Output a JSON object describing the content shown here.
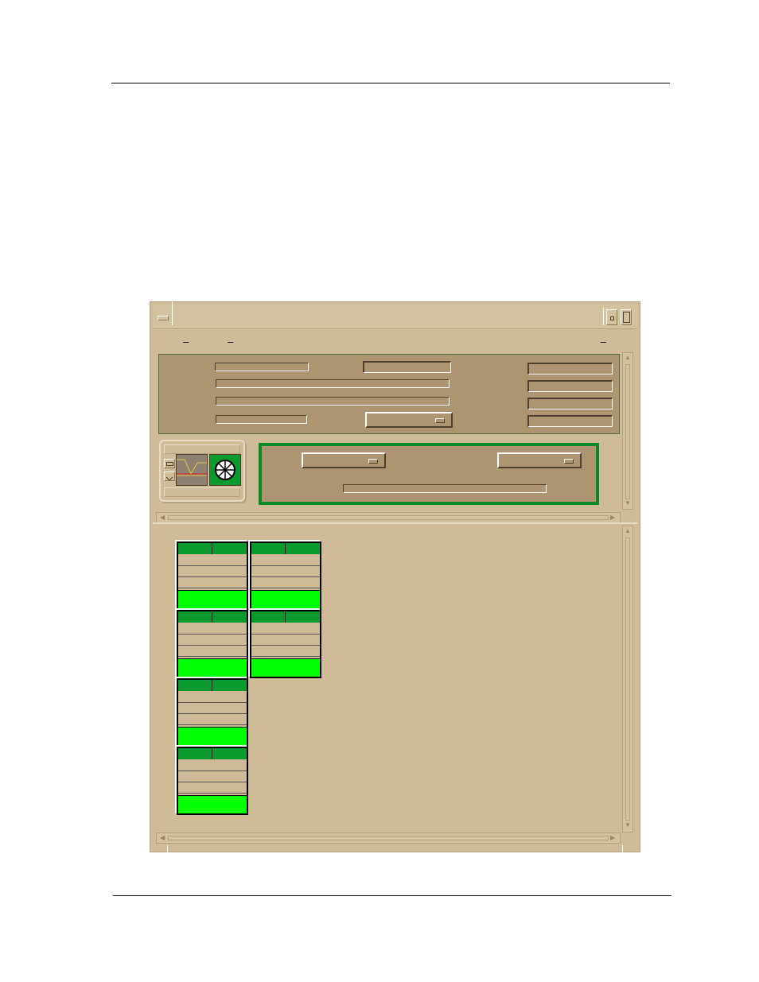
{
  "colors": {
    "window_bg": "#cfbb98",
    "panel_bg": "#ad9571",
    "green_dark": "#0b9a2e",
    "green_bright": "#00ff00",
    "frame_green": "#0a8a26"
  },
  "icons": {
    "window_menu": "window-menu-icon",
    "minimize": "minimize-icon",
    "maximize": "maximize-icon",
    "trend": "trend-graph-icon",
    "wheel": "wheel-icon"
  },
  "menu": {
    "items": [
      {
        "label": ""
      },
      {
        "label": ""
      },
      {
        "label": ""
      }
    ]
  },
  "top_panel": {
    "field_1": "",
    "field_2": "",
    "field_3": "",
    "field_4": "",
    "field_5": "",
    "option_1": "",
    "right_fields": [
      "",
      "",
      "",
      ""
    ]
  },
  "control_panel": {
    "option_a": "",
    "option_b": "",
    "status_field": ""
  },
  "tiles": [
    {
      "col": 0,
      "row": 0
    },
    {
      "col": 1,
      "row": 0
    },
    {
      "col": 0,
      "row": 1
    },
    {
      "col": 1,
      "row": 1
    },
    {
      "col": 0,
      "row": 2
    },
    {
      "col": 0,
      "row": 3
    }
  ]
}
